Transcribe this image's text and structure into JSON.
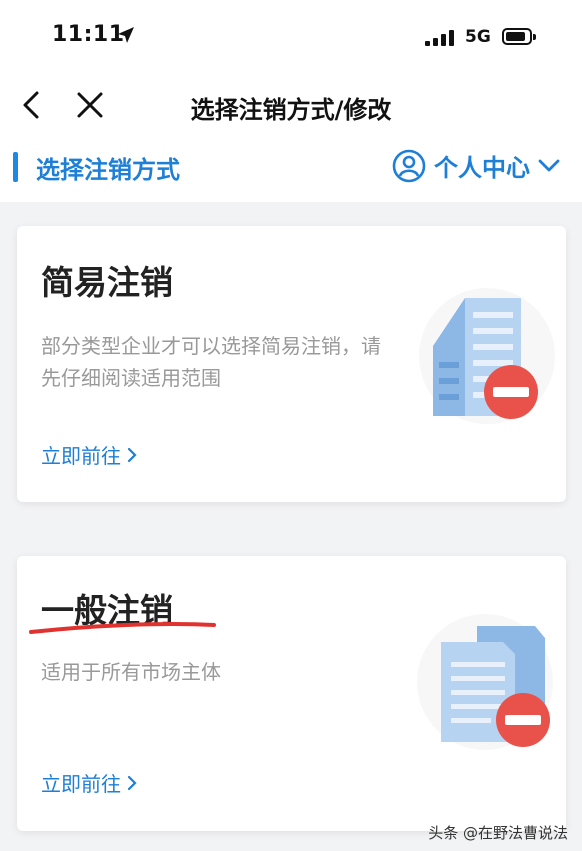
{
  "status_bar": {
    "time": "11:11",
    "network": "5G"
  },
  "nav": {
    "title": "选择注销方式/修改"
  },
  "subheader": {
    "label": "选择注销方式",
    "personal_center": "个人中心"
  },
  "cards": [
    {
      "title": "简易注销",
      "desc": "部分类型企业才可以选择简易注销，请先仔细阅读适用范围",
      "link": "立即前往"
    },
    {
      "title": "一般注销",
      "desc": "适用于所有市场主体",
      "link": "立即前往"
    }
  ],
  "watermark": "头条 @在野法曹说法",
  "colors": {
    "accent": "#1e7fd6",
    "danger": "#e8524a",
    "annotation": "#e0332f"
  }
}
